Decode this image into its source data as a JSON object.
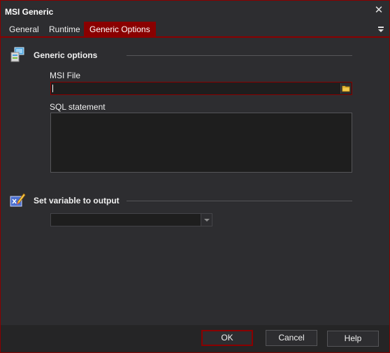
{
  "window": {
    "title": "MSI Generic",
    "close_glyph": "✕",
    "border_color": "#8a0000"
  },
  "tabs": [
    {
      "label": "General",
      "active": false
    },
    {
      "label": "Runtime",
      "active": false
    },
    {
      "label": "Generic Options",
      "active": true
    }
  ],
  "tab_menu_icon": "dropdown-menu-icon",
  "generic_options": {
    "heading": "Generic options",
    "icon": "msi-package-icon",
    "msi_file": {
      "label": "MSI File",
      "value": "",
      "browse_icon": "folder-icon"
    },
    "sql_statement": {
      "label": "SQL statement",
      "value": ""
    }
  },
  "output": {
    "heading": "Set variable to output",
    "icon": "variable-pencil-icon",
    "selected_value": ""
  },
  "buttons": {
    "ok": "OK",
    "cancel": "Cancel",
    "help": "Help"
  },
  "colors": {
    "accent": "#8a0000",
    "background": "#2d2d30",
    "input_background": "#1e1e1e"
  }
}
